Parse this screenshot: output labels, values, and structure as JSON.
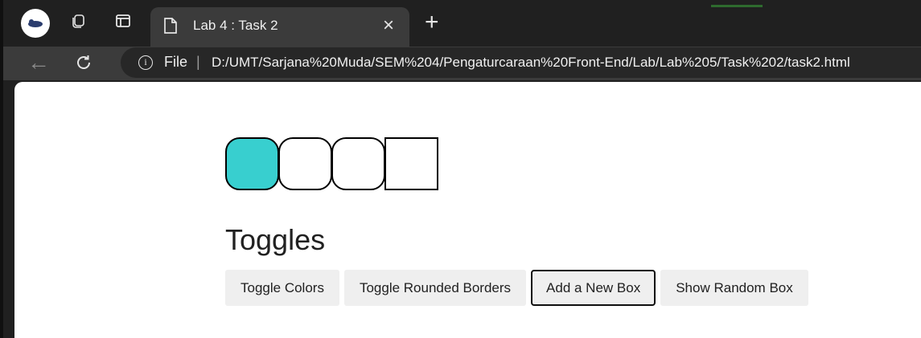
{
  "browser": {
    "tab": {
      "title": "Lab 4 : Task 2",
      "close_glyph": "×"
    },
    "new_tab_glyph": "+",
    "nav": {
      "back_glyph": "←",
      "reload_glyph": "C"
    },
    "omnibox": {
      "info_glyph": "i",
      "scheme_label": "File",
      "separator": "|",
      "url": "D:/UMT/Sarjana%20Muda/SEM%204/Pengaturcaraan%20Front-End/Lab/Lab%205/Task%202/task2.html"
    },
    "icons": {
      "profile": "profile-avatar-icon",
      "workspaces": "workspaces-icon",
      "tab_actions": "tab-actions-icon",
      "document": "document-icon"
    }
  },
  "page": {
    "boxes": [
      {
        "rounded": true,
        "colored": true
      },
      {
        "rounded": true,
        "colored": false
      },
      {
        "rounded": true,
        "colored": false
      },
      {
        "rounded": false,
        "colored": false
      }
    ],
    "box_color": "#38cfcf",
    "heading": "Toggles",
    "buttons": {
      "toggle_colors": "Toggle Colors",
      "toggle_rounded": "Toggle Rounded Borders",
      "add_box": "Add a New Box",
      "random_box": "Show Random Box"
    },
    "focused_button": "add_box"
  }
}
